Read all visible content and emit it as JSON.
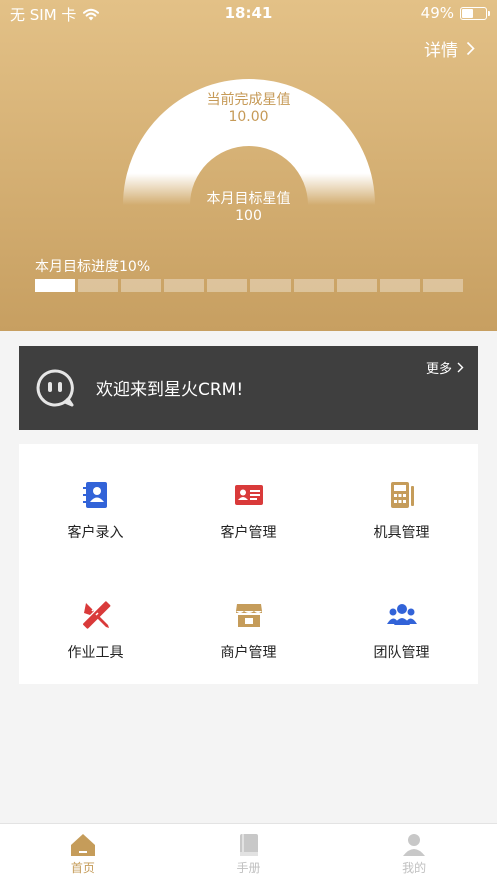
{
  "status_bar": {
    "carrier": "无 SIM 卡",
    "time": "18:41",
    "battery": "49%",
    "battery_level": 0.49
  },
  "header": {
    "detail_label": "详情",
    "gauge_outer_label": "当前完成星值",
    "gauge_outer_value": "10.00",
    "gauge_inner_label": "本月目标星值",
    "gauge_inner_value": "100"
  },
  "progress": {
    "title": "本月目标进度10%",
    "segments_total": 10,
    "segments_filled": 1
  },
  "banner": {
    "welcome": "欢迎来到星火CRM!",
    "more_label": "更多"
  },
  "menu": [
    {
      "label": "客户录入",
      "icon": "contact-book-icon",
      "color": "#3263d8"
    },
    {
      "label": "客户管理",
      "icon": "id-card-icon",
      "color": "#d93a3a"
    },
    {
      "label": "机具管理",
      "icon": "calculator-icon",
      "color": "#c59c5a"
    },
    {
      "label": "作业工具",
      "icon": "pencil-ruler-icon",
      "color": "#d93a3a"
    },
    {
      "label": "商户管理",
      "icon": "shop-icon",
      "color": "#c59c5a"
    },
    {
      "label": "团队管理",
      "icon": "team-icon",
      "color": "#3263d8"
    }
  ],
  "tabbar": [
    {
      "label": "首页",
      "icon": "home-icon",
      "active": true
    },
    {
      "label": "手册",
      "icon": "book-icon",
      "active": false
    },
    {
      "label": "我的",
      "icon": "user-icon",
      "active": false
    }
  ],
  "colors": {
    "gold_light": "#e3c187",
    "gold_dark": "#c79f61",
    "banner_bg": "#3f3f3f",
    "active_tab": "#c59c5a"
  }
}
